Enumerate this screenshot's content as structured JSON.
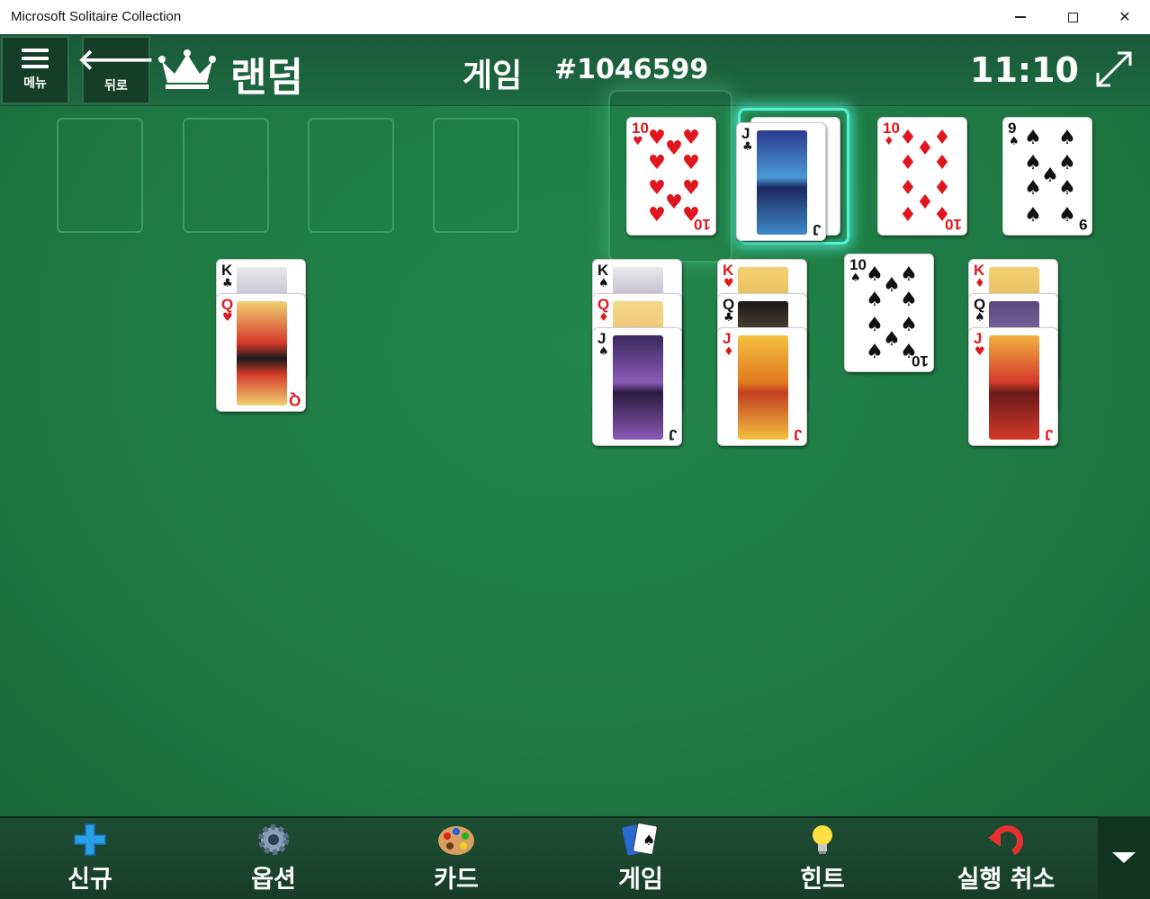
{
  "window": {
    "title": "Microsoft Solitaire Collection"
  },
  "header": {
    "menu_label": "메뉴",
    "back_label": "뒤로",
    "mode": "랜덤",
    "game_label": "게임",
    "game_number": "#1046599",
    "timer": "11:10"
  },
  "foundations": [
    {
      "rank": "10",
      "suit": "♥",
      "color": "red"
    },
    {
      "rank": "J",
      "suit": "♣",
      "color": "black"
    },
    {
      "rank": "10",
      "suit": "♦",
      "color": "red"
    },
    {
      "rank": "9",
      "suit": "♠",
      "color": "black"
    }
  ],
  "tableau": {
    "col1": [
      {
        "rank": "K",
        "suit": "♣"
      },
      {
        "rank": "Q",
        "suit": "♥"
      }
    ],
    "col2": [
      {
        "rank": "K",
        "suit": "♠"
      },
      {
        "rank": "Q",
        "suit": "♦"
      },
      {
        "rank": "J",
        "suit": "♠"
      }
    ],
    "col3": [
      {
        "rank": "K",
        "suit": "♥"
      },
      {
        "rank": "Q",
        "suit": "♣"
      },
      {
        "rank": "J",
        "suit": "♦"
      }
    ],
    "col4": [
      {
        "rank": "10",
        "suit": "♠"
      }
    ],
    "col5": [
      {
        "rank": "K",
        "suit": "♦"
      },
      {
        "rank": "Q",
        "suit": "♠"
      },
      {
        "rank": "J",
        "suit": "♥"
      }
    ]
  },
  "toolbar": {
    "new_label": "신규",
    "options_label": "옵션",
    "cards_label": "카드",
    "game_label": "게임",
    "hint_label": "힌트",
    "undo_label": "실행 취소"
  },
  "colors": {
    "felt": "#1f7a45",
    "highlight": "#53f2d4",
    "red_suit": "#e0161e"
  }
}
